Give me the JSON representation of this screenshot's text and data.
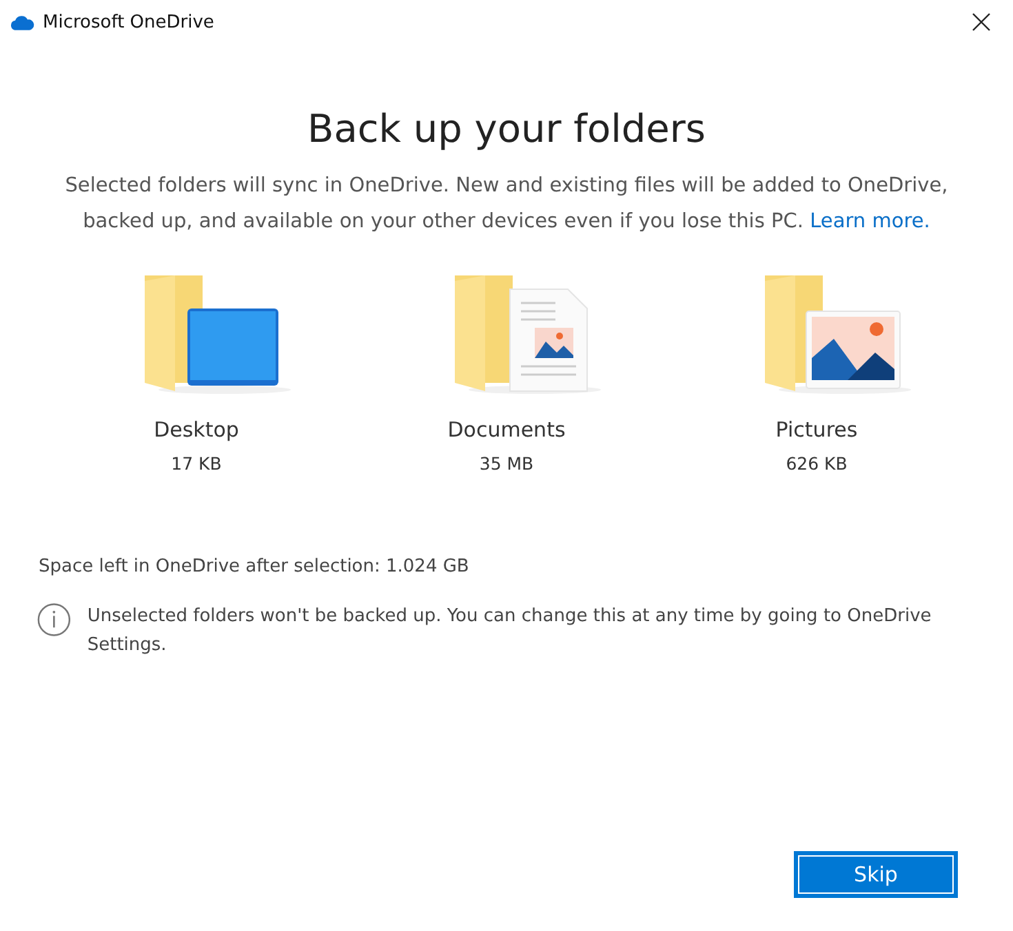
{
  "window": {
    "title": "Microsoft OneDrive"
  },
  "heading": "Back up your folders",
  "description": "Selected folders will sync in OneDrive. New and existing files will be added to OneDrive, backed up, and available on your other devices even if you lose this PC.",
  "link": "Learn more.",
  "folders": [
    {
      "kind": "desktop",
      "name": "Desktop",
      "size": "17 KB"
    },
    {
      "kind": "documents",
      "name": "Documents",
      "size": "35 MB"
    },
    {
      "kind": "pictures",
      "name": "Pictures",
      "size": "626 KB"
    }
  ],
  "space_left": "Space left in OneDrive after selection: 1.024 GB",
  "info": "Unselected folders won't be backed up. You can change this at any time by going to OneDrive Settings.",
  "buttons": [
    "Skip"
  ]
}
